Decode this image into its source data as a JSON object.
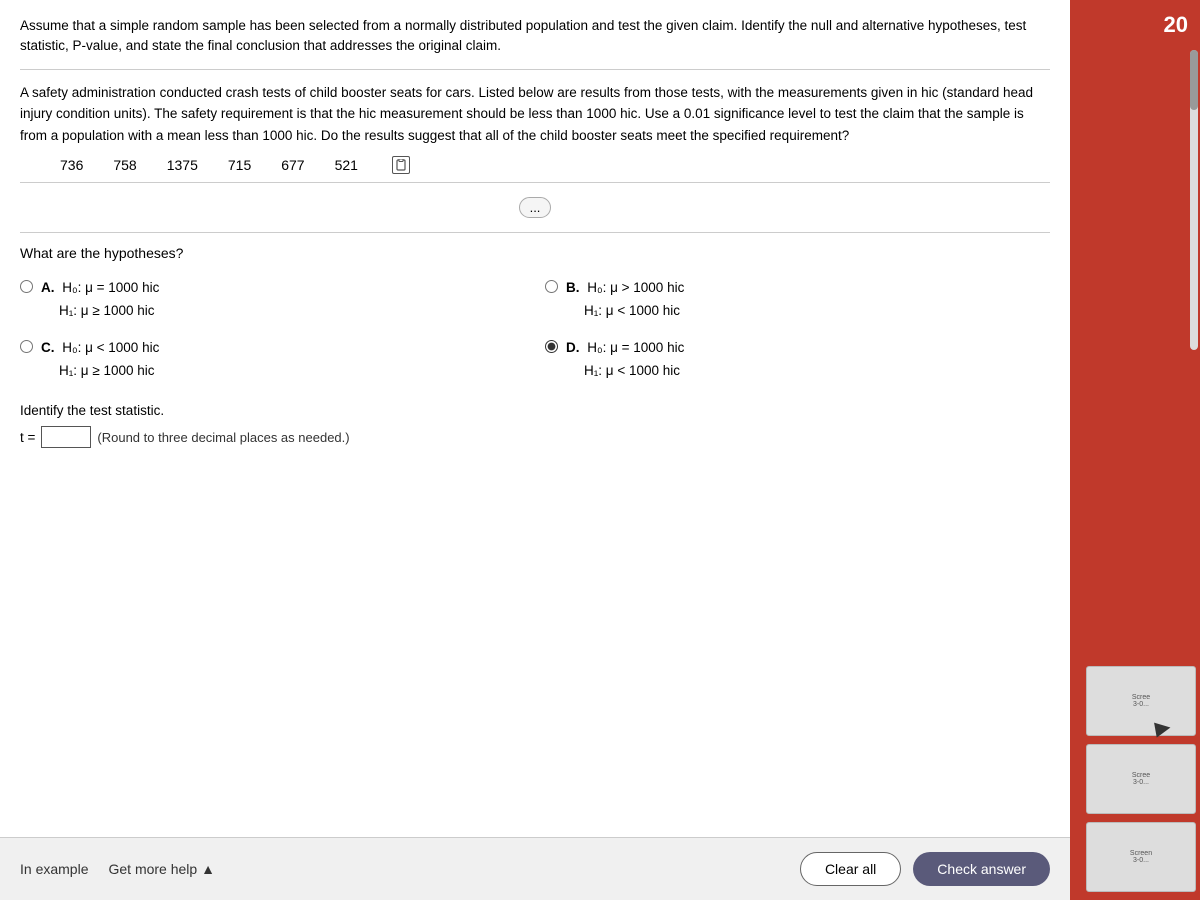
{
  "intro": {
    "paragraph1": "Assume that a simple random sample has been selected from a normally distributed population and test the given claim. Identify the null and alternative hypotheses, test statistic, P-value, and state the final conclusion that addresses the original claim.",
    "paragraph2": "A safety administration conducted crash tests of child booster seats for cars. Listed below are results from those tests, with the measurements given in hic (standard head injury condition units). The safety requirement is that the hic measurement should be less than 1000 hic. Use a 0.01 significance level to test the claim that the sample is from a population with a mean less than 1000 hic. Do the results suggest that all of the child booster seats meet the specified requirement?",
    "data_values": [
      "736",
      "758",
      "1375",
      "715",
      "677",
      "521"
    ]
  },
  "more_button": {
    "label": "..."
  },
  "hypotheses": {
    "label": "What are the hypotheses?",
    "options": [
      {
        "id": "A",
        "selected": false,
        "h0": "H₀: μ = 1000 hic",
        "h1": "H₁: μ ≥ 1000 hic"
      },
      {
        "id": "B",
        "selected": false,
        "h0": "H₀: μ > 1000 hic",
        "h1": "H₁: μ < 1000 hic"
      },
      {
        "id": "C",
        "selected": false,
        "h0": "H₀: μ < 1000 hic",
        "h1": "H₁: μ ≥ 1000 hic"
      },
      {
        "id": "D",
        "selected": true,
        "h0": "H₀: μ = 1000 hic",
        "h1": "H₁: μ < 1000 hic"
      }
    ]
  },
  "test_statistic": {
    "label": "Identify the test statistic.",
    "t_label": "t =",
    "t_value": "",
    "round_note": "(Round to three decimal places as needed.)"
  },
  "bottom": {
    "in_example": "In example",
    "get_more_help": "Get more help ▲",
    "clear_all": "Clear all",
    "check_answer": "Check answer"
  },
  "side_panel": {
    "number": "20",
    "thumbnails": [
      {
        "label": "Scree\n3-0..."
      },
      {
        "label": "Scree\n3-0..."
      },
      {
        "label": "Screen\n3-0..."
      }
    ]
  }
}
